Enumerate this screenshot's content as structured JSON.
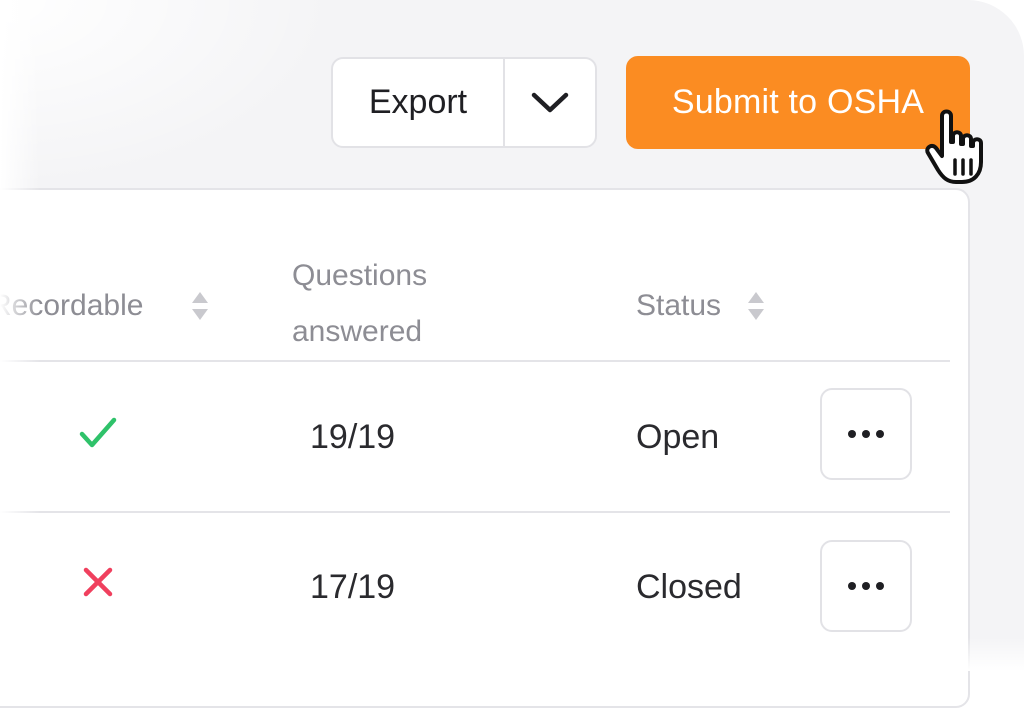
{
  "toolbar": {
    "export_label": "Export",
    "submit_label": "Submit to OSHA"
  },
  "colors": {
    "accent": "#fb8c22",
    "check": "#2fc26a",
    "cross": "#f0405e"
  },
  "table": {
    "headers": {
      "recordable": "Recordable",
      "questions_line1": "Questions",
      "questions_line2": "answered",
      "status": "Status"
    },
    "rows": [
      {
        "recordable": "check-icon",
        "questions": "19/19",
        "status": "Open"
      },
      {
        "recordable": "cross-icon",
        "questions": "17/19",
        "status": "Closed"
      }
    ]
  }
}
